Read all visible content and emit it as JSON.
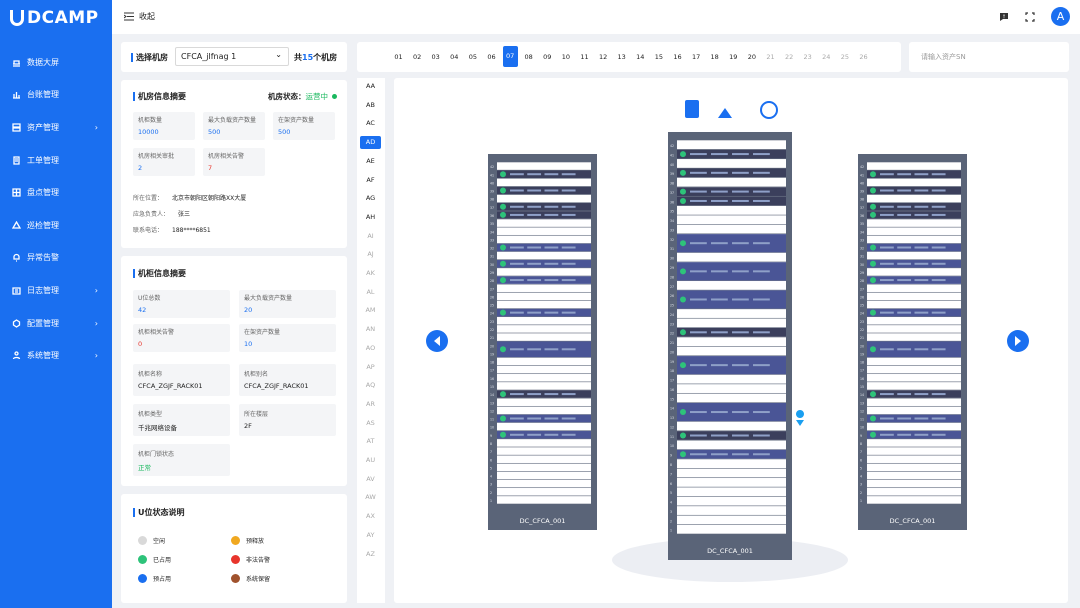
{
  "app": {
    "logo": "DCAMP"
  },
  "sidebar": {
    "items": [
      {
        "label": "数据大屏",
        "chevron": false
      },
      {
        "label": "台账管理",
        "chevron": false
      },
      {
        "label": "资产管理",
        "chevron": true
      },
      {
        "label": "工单管理",
        "chevron": false
      },
      {
        "label": "盘点管理",
        "chevron": false
      },
      {
        "label": "巡检管理",
        "chevron": false
      },
      {
        "label": "异常告警",
        "chevron": false
      },
      {
        "label": "日志管理",
        "chevron": true
      },
      {
        "label": "配置管理",
        "chevron": true
      },
      {
        "label": "系统管理",
        "chevron": true
      }
    ]
  },
  "topbar": {
    "collapse_label": "收起",
    "avatar_letter": "A"
  },
  "room_select": {
    "label": "选择机房",
    "value": "CFCA_jlfnag 1",
    "count_prefix": "共",
    "count": "15",
    "count_suffix": "个机房"
  },
  "room_summary": {
    "title": "机房信息摘要",
    "status_label": "机房状态：",
    "status_value": "运营中",
    "cards": [
      {
        "label": "机柜数量",
        "value": "10000",
        "color": "blue"
      },
      {
        "label": "最大负载资产数量",
        "value": "500",
        "color": "blue"
      },
      {
        "label": "在架资产数量",
        "value": "500",
        "color": "blue"
      },
      {
        "label": "机房相关审批",
        "value": "2",
        "color": "blue"
      },
      {
        "label": "机房相关告警",
        "value": "7",
        "color": "red"
      }
    ],
    "info": [
      {
        "label": "所在位置：",
        "value": "北京市朝阳区朝阳路XX大厦"
      },
      {
        "label": "应急负责人：",
        "value": "张三"
      },
      {
        "label": "联系电话：",
        "value": "188****6851"
      }
    ]
  },
  "cabinet_summary": {
    "title": "机柜信息摘要",
    "cards": [
      {
        "label": "U位总数",
        "value": "42",
        "color": "blue"
      },
      {
        "label": "最大负载资产数量",
        "value": "20",
        "color": "blue"
      },
      {
        "label": "机柜相关告警",
        "value": "0",
        "color": "red"
      },
      {
        "label": "在架资产数量",
        "value": "10",
        "color": "blue"
      },
      {
        "label": "机柜名称",
        "value": "CFCA_ZGJF_RACK01",
        "color": "dark"
      },
      {
        "label": "机柜别名",
        "value": "CFCA_ZGJF_RACK01",
        "color": "dark"
      },
      {
        "label": "机柜类型",
        "value": "千兆网络设备",
        "color": "dark"
      },
      {
        "label": "所在楼层",
        "value": "2F",
        "color": "dark"
      },
      {
        "label": "机柜门锁状态",
        "value": "正常",
        "color": "green"
      }
    ]
  },
  "u_legend": {
    "title": "U位状态说明",
    "items": [
      {
        "label": "空闲",
        "color": "#d9d9d9"
      },
      {
        "label": "预释放",
        "color": "#f0a820"
      },
      {
        "label": "已占用",
        "color": "#2ec37a"
      },
      {
        "label": "非法告警",
        "color": "#e8352c"
      },
      {
        "label": "预占用",
        "color": "#1a6ff0"
      },
      {
        "label": "系统保留",
        "color": "#a0522d"
      }
    ]
  },
  "number_tabs": {
    "items": [
      "01",
      "02",
      "03",
      "04",
      "05",
      "06",
      "07",
      "08",
      "09",
      "10",
      "11",
      "12",
      "13",
      "14",
      "15",
      "16",
      "17",
      "18",
      "19",
      "20",
      "21",
      "22",
      "23",
      "24",
      "25",
      "26"
    ],
    "active": "07",
    "disabled_from": "21"
  },
  "search": {
    "placeholder": "请输入资产SN"
  },
  "row_list": {
    "items": [
      "AA",
      "AB",
      "AC",
      "AD",
      "AE",
      "AF",
      "AG",
      "AH",
      "AI",
      "AJ",
      "AK",
      "AL",
      "AM",
      "AN",
      "AO",
      "AP",
      "AQ",
      "AR",
      "AS",
      "AT",
      "AU",
      "AV",
      "AW",
      "AX",
      "AY",
      "AZ"
    ],
    "active": "AD",
    "disabled_from": "AI"
  },
  "racks": {
    "left_name": "DC_CFCA_001",
    "center_name": "DC_CFCA_001",
    "right_name": "DC_CFCA_001",
    "u_count": 42
  },
  "colors": {
    "accent": "#1a6ff0",
    "rack_frame": "#5a6478",
    "device_dark": "#3b3f5c",
    "device_blue": "#4a5596"
  },
  "icons": [
    "dashboard-icon",
    "ledger-icon",
    "asset-icon",
    "workorder-icon",
    "inventory-icon",
    "patrol-icon",
    "alarm-icon",
    "log-icon",
    "config-icon",
    "system-icon",
    "collapse-icon",
    "message-icon",
    "fullscreen-icon",
    "lock-device-icon",
    "power-alert-icon",
    "network-device-icon",
    "prev-arrow-icon",
    "next-arrow-icon",
    "location-pin-icon"
  ]
}
